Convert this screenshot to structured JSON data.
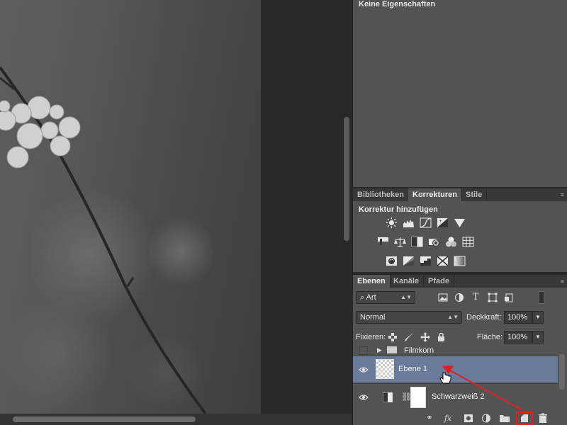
{
  "properties": {
    "title": "Keine Eigenschaften"
  },
  "adjustments_tabs": [
    {
      "label": "Bibliotheken",
      "active": false
    },
    {
      "label": "Korrekturen",
      "active": true
    },
    {
      "label": "Stile",
      "active": false
    }
  ],
  "adjustments": {
    "heading": "Korrektur hinzufügen",
    "icons_row1": [
      "brightness-icon",
      "levels-icon",
      "curves-icon",
      "exposure-icon",
      "vibrance-icon"
    ],
    "icons_row2": [
      "hue-saturation-icon",
      "color-balance-icon",
      "black-white-icon",
      "photo-filter-icon",
      "channel-mixer-icon",
      "color-lookup-icon"
    ],
    "icons_row3": [
      "invert-icon",
      "posterize-icon",
      "threshold-icon",
      "selective-color-icon",
      "gradient-map-icon"
    ]
  },
  "layers_tabs": [
    {
      "label": "Ebenen",
      "active": true
    },
    {
      "label": "Kanäle",
      "active": false
    },
    {
      "label": "Pfade",
      "active": false
    }
  ],
  "layers": {
    "filter_kind": "Art",
    "blend_mode": "Normal",
    "opacity_label": "Deckkraft:",
    "opacity_value": "100%",
    "lock_label": "Fixieren:",
    "fill_label": "Fläche:",
    "fill_value": "100%",
    "rows": [
      {
        "name": "Filmkorn",
        "type": "group",
        "visible": false,
        "selected": false
      },
      {
        "name": "Ebene 1",
        "type": "pixel",
        "visible": true,
        "selected": true
      },
      {
        "name": "Schwarzweiß 2",
        "type": "adjustment",
        "visible": true,
        "selected": false
      }
    ]
  },
  "colors": {
    "selected_layer": "#6a7a9a",
    "annotation_red": "#e02020",
    "panel_bg": "#535353"
  }
}
